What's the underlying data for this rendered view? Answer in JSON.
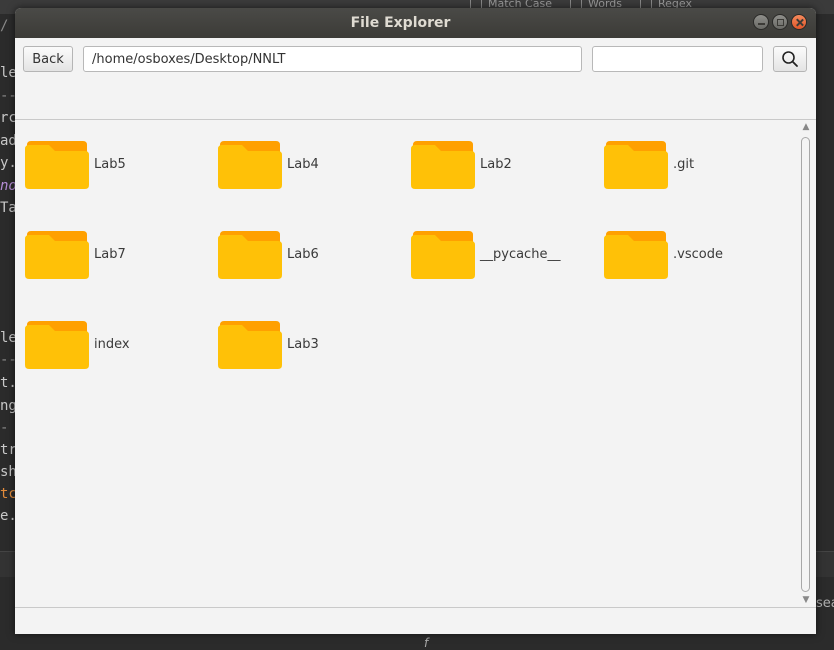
{
  "background_editor": {
    "find_options": [
      "Match Case",
      "Words",
      "Regex"
    ],
    "code_fragments": [
      "/ ",
      "le",
      "-->",
      "rc",
      "ad",
      "y.c",
      "no",
      "Tal",
      "le",
      "-->",
      "t.c",
      "ng",
      "-",
      "tra",
      "sho",
      "tc",
      "e.p"
    ],
    "search_hint": "sea",
    "fx_label": "f"
  },
  "window": {
    "title": "File Explorer",
    "controls": {
      "minimize": "minimize",
      "maximize": "maximize",
      "close": "close"
    }
  },
  "toolbar": {
    "back_label": "Back",
    "path_value": "/home/osboxes/Desktop/NNLT",
    "search_value": "",
    "search_icon": "search-icon"
  },
  "folders": [
    "Lab5",
    "Lab4",
    "Lab2",
    ".git",
    "Lab7",
    "Lab6",
    "__pycache__",
    ".vscode",
    "index",
    "Lab3"
  ],
  "colors": {
    "folder_back": "#ffa000",
    "folder_front": "#ffc107",
    "titlebar": "#3c3b37",
    "close_button": "#e0562a"
  }
}
